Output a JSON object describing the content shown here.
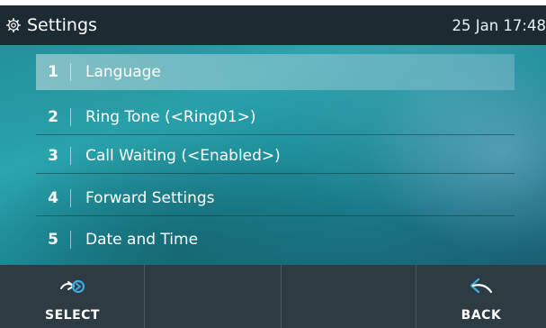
{
  "header": {
    "title": "Settings",
    "datetime": "25 Jan 17:48",
    "icon": "gear-icon"
  },
  "menu": {
    "items": [
      {
        "number": "1",
        "label": "Language",
        "selected": true
      },
      {
        "number": "2",
        "label": "Ring Tone (<Ring01>)",
        "selected": false
      },
      {
        "number": "3",
        "label": "Call Waiting (<Enabled>)",
        "selected": false
      },
      {
        "number": "4",
        "label": "Forward Settings",
        "selected": false
      },
      {
        "number": "5",
        "label": "Date and Time",
        "selected": false
      }
    ]
  },
  "softkeys": {
    "select": {
      "label": "SELECT",
      "icon": "select-arrow-icon"
    },
    "empty2": {
      "label": ""
    },
    "empty3": {
      "label": ""
    },
    "back": {
      "label": "BACK",
      "icon": "back-arrow-icon"
    }
  },
  "colors": {
    "header_bg": "#1c2b32",
    "softkey_bg": "#2d3b42",
    "accent_blue": "#3fa9e0"
  }
}
